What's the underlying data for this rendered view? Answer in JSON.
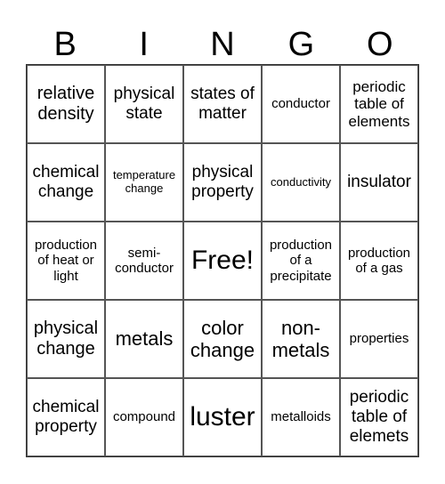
{
  "header": {
    "letters": [
      "B",
      "I",
      "N",
      "G",
      "O"
    ]
  },
  "grid": {
    "rows": [
      [
        "relative density",
        "physical state",
        "states of matter",
        "conductor",
        "periodic table of elements"
      ],
      [
        "chemical change",
        "temperature change",
        "physical property",
        "conductivity",
        "insulator"
      ],
      [
        "production of heat or light",
        "semi-conductor",
        "Free!",
        "production of a precipitate",
        "production of a gas"
      ],
      [
        "physical change",
        "metals",
        "color change",
        "non-metals",
        "properties"
      ],
      [
        "chemical property",
        "compound",
        "luster",
        "metalloids",
        "periodic table of elemets"
      ]
    ]
  }
}
